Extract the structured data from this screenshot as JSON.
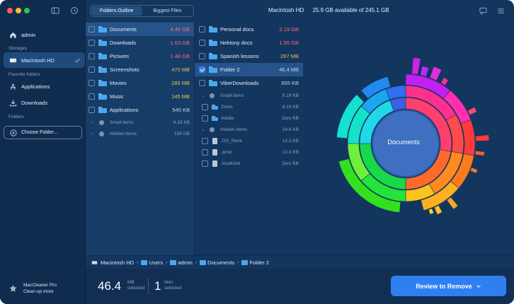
{
  "header": {
    "tabs": [
      "Folders Outline",
      "Biggest Files"
    ],
    "active_tab": 0,
    "disk_name": "Macintosh HD",
    "disk_info": "25.9 GB available of 245.1 GB"
  },
  "sidebar": {
    "user": "admin",
    "storages_label": "Storages",
    "storage": "Macintosh HD",
    "favorites_label": "Favorite folders",
    "favorites": [
      "Applications",
      "Downloads"
    ],
    "folders_label": "Folders",
    "choose_label": "Choose Folder...",
    "app_name": "MacCleaner Pro",
    "app_sub": "Clean up more"
  },
  "col1": [
    {
      "name": "Documents",
      "size": "4.46 GB",
      "color": "#ff6b6b",
      "selected": true
    },
    {
      "name": "Downloads",
      "size": "1.63 GB",
      "color": "#ff6b6b"
    },
    {
      "name": "Pictures",
      "size": "1.48 GB",
      "color": "#ff6b6b"
    },
    {
      "name": "Screenshots",
      "size": "470 MB",
      "color": "#f2c14e"
    },
    {
      "name": "Movies",
      "size": "285 MB",
      "color": "#f2c14e"
    },
    {
      "name": "Music",
      "size": "145 MB",
      "color": "#f2c14e"
    },
    {
      "name": "Applications",
      "size": "545 KB",
      "color": "#c9d4e4"
    },
    {
      "name": "Small items",
      "size": "8.19 KB",
      "color": "#8ea3c0"
    },
    {
      "name": "Hidden items",
      "size": "158 GB",
      "color": "#8ea3c0"
    }
  ],
  "col2": [
    {
      "name": "Personal docs",
      "size": "2.19 GB",
      "color": "#ff6b6b"
    },
    {
      "name": "Nektony docs",
      "size": "1.95 GB",
      "color": "#ff6b6b"
    },
    {
      "name": "Spanish lessons",
      "size": "267 MB",
      "color": "#f2c14e"
    },
    {
      "name": "Folder 2",
      "size": "46.4 MB",
      "color": "#c9d4e4"
    },
    {
      "name": "ViberDownloads",
      "size": "655 KB",
      "color": "#c9d4e4"
    },
    {
      "name": "Small items",
      "size": "8.19 KB",
      "color": "#8ea3c0"
    },
    {
      "name": "Zoom",
      "size": "8.19 KB",
      "color": "#8ea3c0"
    },
    {
      "name": "Adobe",
      "size": "Zero KB",
      "color": "#8ea3c0"
    },
    {
      "name": "Hidden items",
      "size": "24.6 KB",
      "color": "#8ea3c0"
    },
    {
      "name": ".DS_Store",
      "size": "12.3 KB",
      "color": "#8ea3c0"
    },
    {
      "name": ".qmei",
      "size": "12.3 KB",
      "color": "#8ea3c0"
    },
    {
      "name": ".localized",
      "size": "Zero KB",
      "color": "#8ea3c0"
    }
  ],
  "chart": {
    "center_label": "Documents"
  },
  "breadcrumb": [
    "Macintosh HD",
    "Users",
    "admin",
    "Documents",
    "Folder 2"
  ],
  "footer": {
    "size_value": "46.4",
    "size_unit": "MB",
    "size_caption": "selected",
    "count_value": "1",
    "count_unit": "item",
    "count_caption": "selected",
    "review_label": "Review to Remove"
  }
}
